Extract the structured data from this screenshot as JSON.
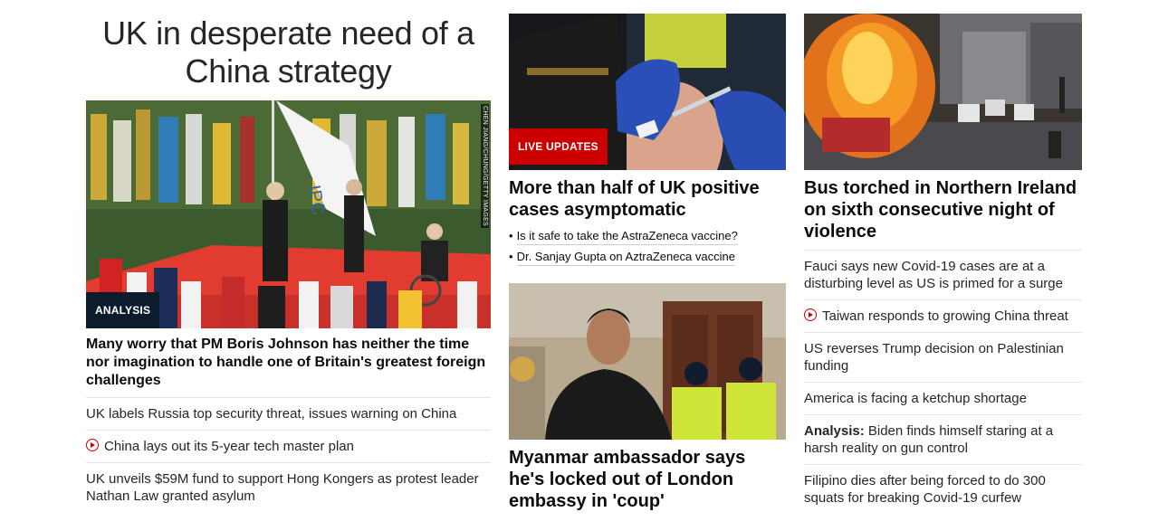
{
  "col1": {
    "headline": "UK in desperate need of a China strategy",
    "image_credit": "CHEN JIANG/CHUNG/GETTY IMAGES",
    "tag": "ANALYSIS",
    "lead": "Many worry that PM Boris Johnson has neither the time nor imagination to handle one of Britain's greatest foreign challenges",
    "items": [
      {
        "text": "UK labels Russia top security threat, issues warning on China",
        "video": false
      },
      {
        "text": "China lays out its 5-year tech master plan",
        "video": true
      },
      {
        "text": "UK unveils $59M fund to support Hong Kongers as protest leader Nathan Law granted asylum",
        "video": false
      }
    ]
  },
  "col2": {
    "card1": {
      "tag": "LIVE UPDATES",
      "title": "More than half of UK positive cases asymptomatic",
      "sub_links": [
        "Is it safe to take the AstraZeneca vaccine?",
        "Dr. Sanjay Gupta on AztraZeneca vaccine"
      ]
    },
    "card2": {
      "title": "Myanmar ambassador says he's locked out of London embassy in 'coup'"
    }
  },
  "col3": {
    "title": "Bus torched in Northern Ireland on sixth consecutive night of violence",
    "items": [
      {
        "prefix": "",
        "text": "Fauci says new Covid-19 cases are at a disturbing level as US is primed for a surge",
        "video": false
      },
      {
        "prefix": "",
        "text": "Taiwan responds to growing China threat",
        "video": true
      },
      {
        "prefix": "",
        "text": "US reverses Trump decision on Palestinian funding",
        "video": false
      },
      {
        "prefix": "",
        "text": "America is facing a ketchup shortage",
        "video": false
      },
      {
        "prefix": "Analysis:",
        "text": " Biden finds himself staring at a harsh reality on gun control",
        "video": false
      },
      {
        "prefix": "",
        "text": "Filipino dies after being forced to do 300 squats for breaking Covid-19 curfew",
        "video": false
      }
    ]
  },
  "colors": {
    "live_red": "#cc0000",
    "analysis_navy": "#0c1c2c",
    "divider": "#e6e6e6"
  }
}
